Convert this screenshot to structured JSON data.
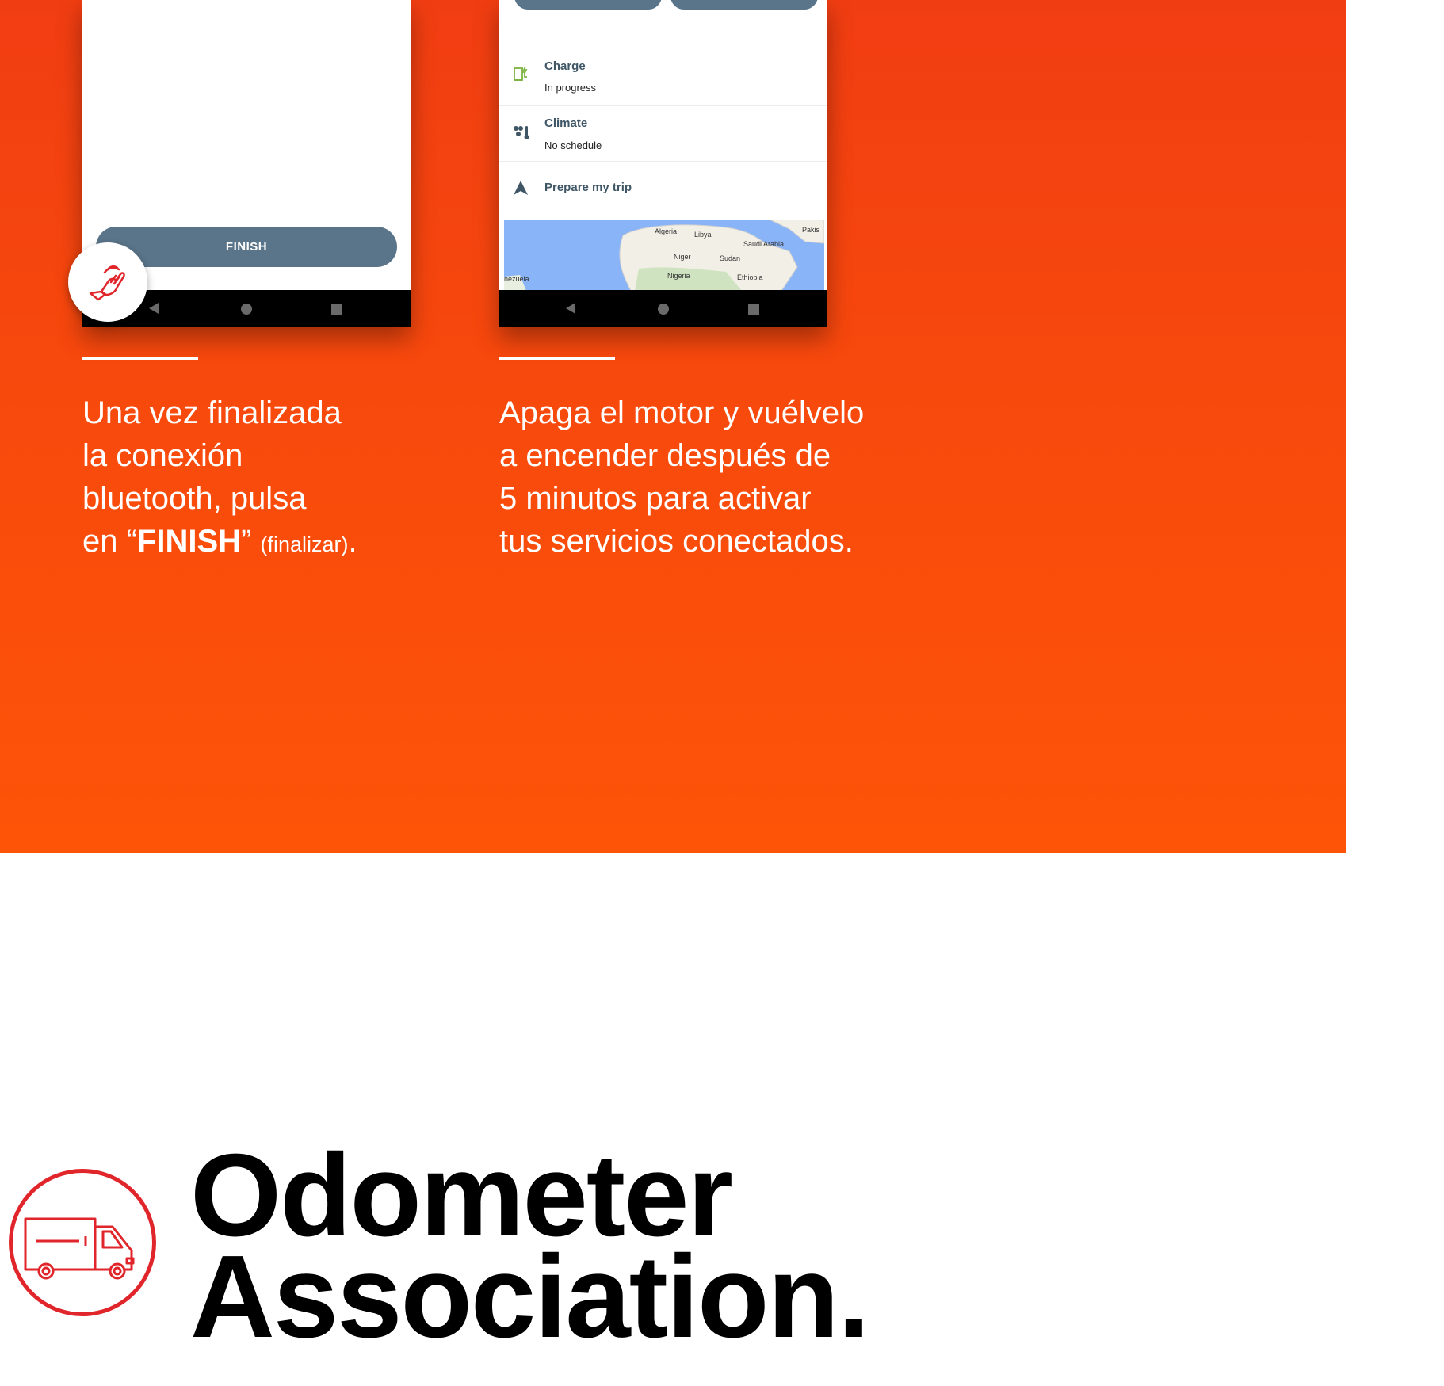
{
  "colors": {
    "hero_top": "#f13d12",
    "hero_bottom": "#fd5408",
    "button": "#5a7489",
    "brand_red": "#e0252b"
  },
  "phone1": {
    "finish_label": "FINISH",
    "icons": {
      "touch": "hand-tap-icon",
      "back": "nav-back-icon",
      "home": "nav-home-icon",
      "recent": "nav-recent-icon"
    }
  },
  "phone2": {
    "charge": {
      "title": "Charge",
      "subtitle": "In progress",
      "icon": "charging-station-icon"
    },
    "climate": {
      "title": "Climate",
      "subtitle": "No schedule",
      "icon": "climate-fan-icon"
    },
    "trip": {
      "title": "Prepare my trip",
      "icon": "navigation-arrow-icon"
    },
    "map_labels": {
      "algeria": "Algeria",
      "libya": "Libya",
      "saudi": "Saudi Arabia",
      "pakis": "Pakis",
      "niger": "Niger",
      "sudan": "Sudan",
      "nigeria": "Nigeria",
      "ethiopia": "Ethiopia",
      "venezuela": "nezuela"
    }
  },
  "caption1": {
    "line1": "Una vez finalizada",
    "line2": "la conexión",
    "line3": "bluetooth, pulsa",
    "line4_pre": "en “",
    "line4_bold": "FINISH",
    "line4_post": "” ",
    "line4_small": "(finalizar)",
    "line4_end": "."
  },
  "caption2": {
    "line1": "Apaga el motor y vuélvelo",
    "line2": "a encender después de",
    "line3": "5 minutos para activar",
    "line4": "tus servicios conectados."
  },
  "brand": {
    "line1": "Odometer",
    "line2": "Association.",
    "icon": "delivery-van-icon"
  }
}
